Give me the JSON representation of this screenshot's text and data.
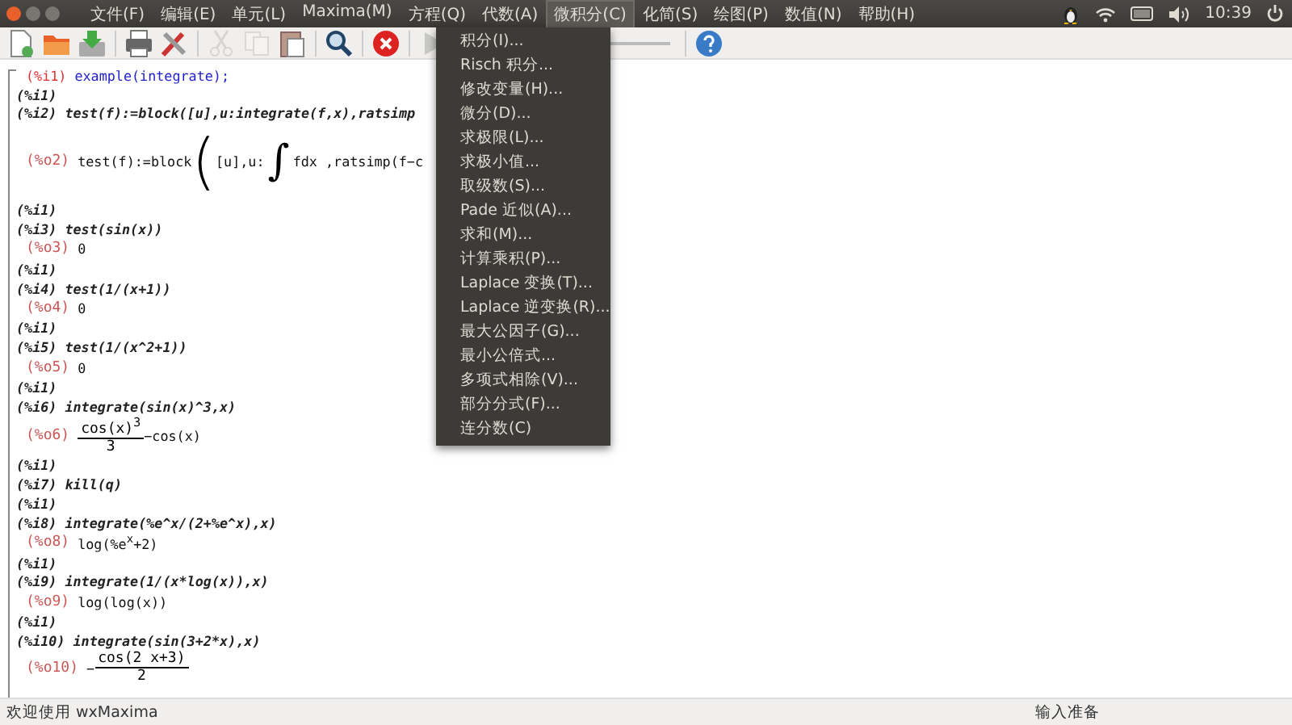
{
  "menubar": {
    "items": [
      {
        "label": "文件(F)",
        "selected": false
      },
      {
        "label": "编辑(E)",
        "selected": false
      },
      {
        "label": "单元(L)",
        "selected": false
      },
      {
        "label": "Maxima(M)",
        "selected": false
      },
      {
        "label": "方程(Q)",
        "selected": false
      },
      {
        "label": "代数(A)",
        "selected": false
      },
      {
        "label": "微积分(C)",
        "selected": true
      },
      {
        "label": "化简(S)",
        "selected": false
      },
      {
        "label": "绘图(P)",
        "selected": false
      },
      {
        "label": "数值(N)",
        "selected": false
      },
      {
        "label": "帮助(H)",
        "selected": false
      }
    ],
    "clock": "10:39"
  },
  "toolbar": [
    {
      "kind": "new",
      "disabled": false
    },
    {
      "kind": "open",
      "disabled": false
    },
    {
      "kind": "save",
      "disabled": false
    },
    {
      "kind": "sep"
    },
    {
      "kind": "print",
      "disabled": false
    },
    {
      "kind": "tools",
      "disabled": false
    },
    {
      "kind": "sep"
    },
    {
      "kind": "cut",
      "disabled": true
    },
    {
      "kind": "copy",
      "disabled": true
    },
    {
      "kind": "paste",
      "disabled": false
    },
    {
      "kind": "sep"
    },
    {
      "kind": "search",
      "disabled": false
    },
    {
      "kind": "sep"
    },
    {
      "kind": "stop",
      "disabled": false
    },
    {
      "kind": "sep"
    },
    {
      "kind": "play",
      "disabled": true
    },
    {
      "kind": "slider"
    },
    {
      "kind": "sep"
    },
    {
      "kind": "help",
      "disabled": false
    }
  ],
  "worksheet": [
    {
      "kind": "input",
      "label": "(%i1)",
      "code": "example(integrate);",
      "active": true
    },
    {
      "kind": "input",
      "label": "(%i1)",
      "active": false
    },
    {
      "kind": "input",
      "label": "(%i2)",
      "code": "test(f):=block([u],u:integrate(f,x),ratsimp",
      "active": false
    },
    {
      "kind": "output",
      "label": "(%o2)",
      "tall": true,
      "parts": [
        {
          "kind": "text",
          "text": "test(f):=block"
        },
        {
          "kind": "paren",
          "text": "("
        },
        {
          "kind": "text",
          "text": "[u],u:"
        },
        {
          "kind": "integral",
          "text": "∫"
        },
        {
          "kind": "text",
          "text": "fdx ,ratsimp(f−c"
        }
      ]
    },
    {
      "kind": "input",
      "label": "(%i1)",
      "active": false
    },
    {
      "kind": "input",
      "label": "(%i3)",
      "code": "test(sin(x))",
      "active": false
    },
    {
      "kind": "output",
      "label": "(%o3)",
      "parts": [
        {
          "kind": "text",
          "text": "0"
        }
      ]
    },
    {
      "kind": "input",
      "label": "(%i1)",
      "active": false
    },
    {
      "kind": "input",
      "label": "(%i4)",
      "code": "test(1/(x+1))",
      "active": false
    },
    {
      "kind": "output",
      "label": "(%o4)",
      "parts": [
        {
          "kind": "text",
          "text": "0"
        }
      ]
    },
    {
      "kind": "input",
      "label": "(%i1)",
      "active": false
    },
    {
      "kind": "input",
      "label": "(%i5)",
      "code": "test(1/(x^2+1))",
      "active": false
    },
    {
      "kind": "output",
      "label": "(%o5)",
      "parts": [
        {
          "kind": "text",
          "text": "0"
        }
      ]
    },
    {
      "kind": "input",
      "label": "(%i1)",
      "active": false
    },
    {
      "kind": "input",
      "label": "(%i6)",
      "code": "integrate(sin(x)^3,x)",
      "active": false
    },
    {
      "kind": "output",
      "label": "(%o6)",
      "parts": [
        {
          "kind": "frac",
          "num": "cos(x)$^{3}$",
          "den": "3"
        },
        {
          "kind": "text",
          "text": "−cos(x)"
        }
      ]
    },
    {
      "kind": "input",
      "label": "(%i1)",
      "active": false
    },
    {
      "kind": "input",
      "label": "(%i7)",
      "code": "kill(q)",
      "active": false
    },
    {
      "kind": "input",
      "label": "(%i1)",
      "active": false
    },
    {
      "kind": "input",
      "label": "(%i8)",
      "code": "integrate(%e^x/(2+%e^x),x)",
      "active": false
    },
    {
      "kind": "output",
      "label": "(%o8)",
      "parts": [
        {
          "kind": "text",
          "text": "log(%e$^{x}$+2)"
        }
      ]
    },
    {
      "kind": "input",
      "label": "(%i1)",
      "active": false
    },
    {
      "kind": "input",
      "label": "(%i9)",
      "code": "integrate(1/(x*log(x)),x)",
      "active": false
    },
    {
      "kind": "output",
      "label": "(%o9)",
      "parts": [
        {
          "kind": "text",
          "text": "log(log(x))"
        }
      ]
    },
    {
      "kind": "input",
      "label": "(%i1)",
      "active": false
    },
    {
      "kind": "input",
      "label": "(%i10)",
      "code": "integrate(sin(3+2*x),x)",
      "active": false
    },
    {
      "kind": "output",
      "label": "(%o10)",
      "parts": [
        {
          "kind": "text",
          "text": "−"
        },
        {
          "kind": "frac",
          "num": "cos(2 x+3)",
          "den": "2"
        }
      ]
    }
  ],
  "dropdown": [
    "积分(I)...",
    "Risch 积分...",
    "修改变量(H)...",
    "微分(D)...",
    "求极限(L)...",
    "求极小值...",
    "取级数(S)...",
    "Pade 近似(A)...",
    "求和(M)...",
    "计算乘积(P)...",
    "Laplace 变换(T)...",
    "Laplace 逆变换(R)...",
    "最大公因子(G)...",
    "最小公倍式...",
    "多项式相除(V)...",
    "部分分式(F)...",
    "连分数(C)"
  ],
  "status_bar": {
    "left": "欢迎使用 wxMaxima",
    "right": "输入准备"
  }
}
